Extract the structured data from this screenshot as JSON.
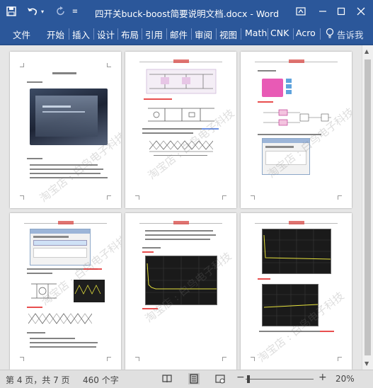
{
  "titlebar": {
    "title": "四开关buck-boost简要说明文档.docx - Word",
    "save_icon": "save-icon",
    "undo_icon": "undo-icon",
    "redo_icon": "redo-icon"
  },
  "ribbon": {
    "tabs": [
      "文件",
      "开始",
      "插入",
      "设计",
      "布局",
      "引用",
      "邮件",
      "审阅",
      "视图",
      "Math",
      "CNK",
      "Acro"
    ],
    "tell_me": "告诉我"
  },
  "document": {
    "pages": 6,
    "watermark": "淘宝店 : 白鸟电子科技"
  },
  "statusbar": {
    "page_info": "第 4 页，共 7 页",
    "word_count": "460 个字",
    "zoom": "20%",
    "zoom_minus": "−",
    "zoom_plus": "+"
  },
  "colors": {
    "accent": "#2b579a",
    "workspace": "#e6e6e6"
  }
}
